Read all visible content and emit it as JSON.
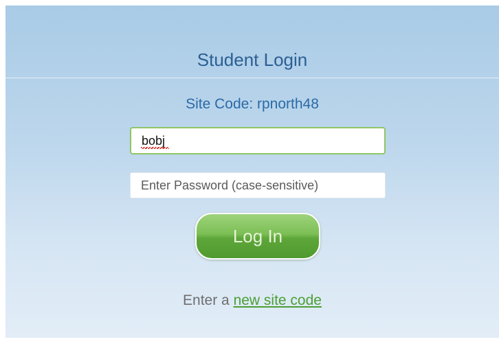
{
  "login": {
    "title": "Student Login",
    "site_code_text": "Site Code: rpnorth48",
    "username_value": "bobj",
    "password_placeholder": "Enter Password (case-sensitive)",
    "login_button_label": "Log In",
    "new_site_prefix": "Enter a ",
    "new_site_link": "new site code"
  },
  "colors": {
    "title": "#2b5f93",
    "button_green": "#6db447",
    "link_green": "#4c9e35"
  }
}
